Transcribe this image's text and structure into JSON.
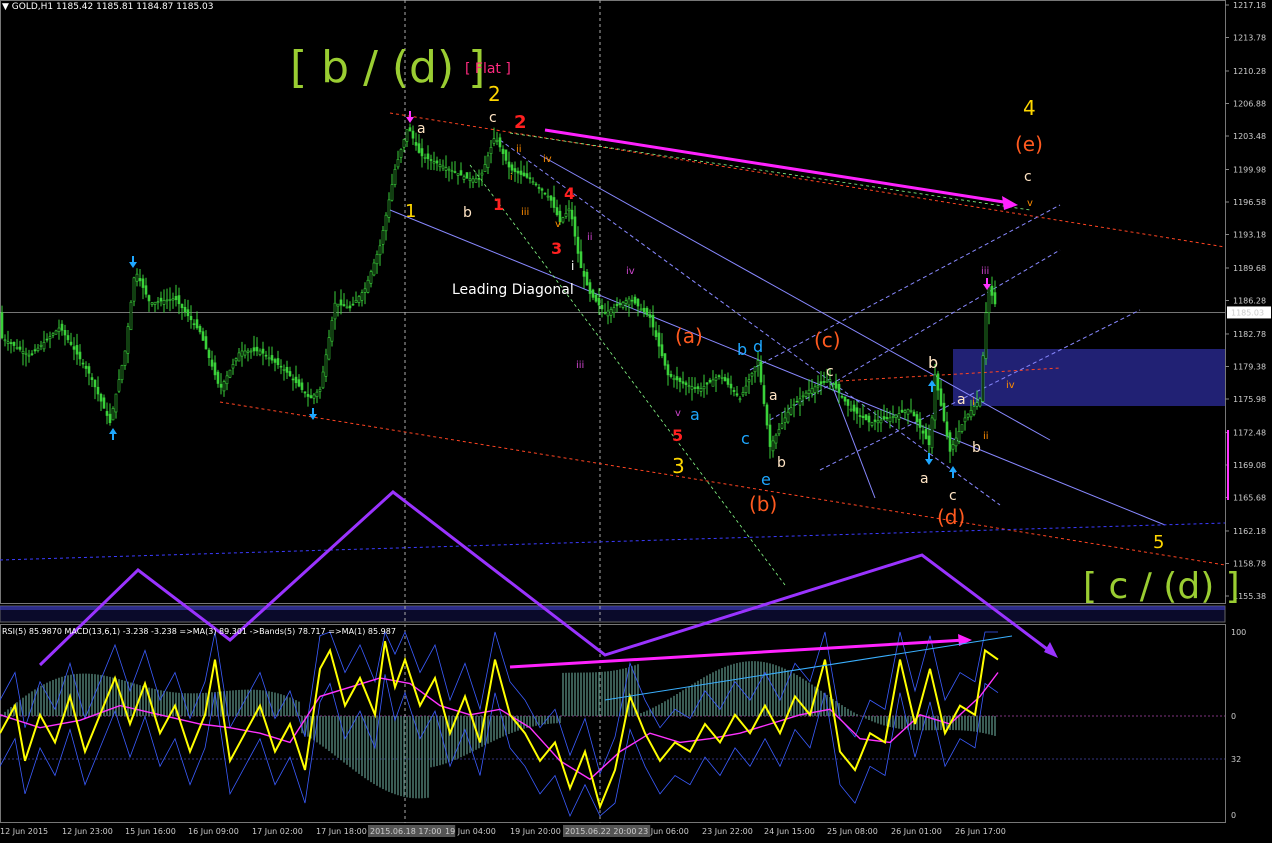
{
  "chart_header": {
    "symbol_label": "GOLD,H1",
    "ohlc": "1185.42 1185.81 1184.87 1185.03"
  },
  "indicator_header": "RSI(5) 85.9870  MACD(13,6,1) -3.238 -3.238  =>MA(3) 89.301  ->Bands(5) 78.717  =>MA(1) 85.987",
  "colors": {
    "background": "#000000",
    "candle": "#3ad13a",
    "rsi": "#ffff00",
    "rsi_ma": "#ff33ff",
    "bands": "#3b5cff",
    "magenta_arrow": "#ff22ff",
    "purple_path": "#9a33ff",
    "channel": "#8888ff",
    "trend_red": "#ff4422",
    "zone": "#23237a"
  },
  "chart_data": [
    {
      "type": "candlestick",
      "symbol": "GOLD",
      "timeframe": "H1",
      "price_ticks": [
        "1217.18",
        "1213.78",
        "1210.28",
        "1206.88",
        "1203.48",
        "1199.98",
        "1196.58",
        "1193.18",
        "1189.68",
        "1186.28",
        "1182.78",
        "1179.38",
        "1175.98",
        "1172.48",
        "1169.08",
        "1165.68",
        "1162.18",
        "1158.78",
        "1155.38"
      ],
      "ylim": [
        1153.5,
        1218.5
      ],
      "current_price": "1185.03",
      "time_ticks": [
        "12 Jun 2015",
        "12 Jun 23:00",
        "15 Jun 16:00",
        "16 Jun 09:00",
        "17 Jun 02:00",
        "17 Jun 18:00",
        "2015.06.18 17:00",
        "19 Jun 04:00",
        "19 Jun 20:00",
        "2015.06.22 20:00",
        "23 Jun 06:00",
        "23 Jun 22:00",
        "24 Jun 15:00",
        "25 Jun 08:00",
        "26 Jun 01:00",
        "26 Jun 17:00"
      ],
      "close_path": [
        [
          0,
          1182.5
        ],
        [
          30,
          1180.5
        ],
        [
          60,
          1183.5
        ],
        [
          90,
          1178.5
        ],
        [
          110,
          1173.5
        ],
        [
          125,
          1181
        ],
        [
          135,
          1189.5
        ],
        [
          150,
          1186
        ],
        [
          175,
          1186.5
        ],
        [
          200,
          1183
        ],
        [
          220,
          1177
        ],
        [
          240,
          1181
        ],
        [
          260,
          1181
        ],
        [
          285,
          1179
        ],
        [
          310,
          1176
        ],
        [
          320,
          1177
        ],
        [
          335,
          1186
        ],
        [
          350,
          1185.5
        ],
        [
          365,
          1187.5
        ],
        [
          380,
          1192
        ],
        [
          395,
          1200
        ],
        [
          408,
          1204.5
        ],
        [
          420,
          1201.5
        ],
        [
          440,
          1200.5
        ],
        [
          468,
          1199
        ],
        [
          480,
          1199
        ],
        [
          495,
          1203.5
        ],
        [
          510,
          1200
        ],
        [
          530,
          1199
        ],
        [
          550,
          1197
        ],
        [
          560,
          1194.5
        ],
        [
          570,
          1196
        ],
        [
          580,
          1190
        ],
        [
          590,
          1187
        ],
        [
          605,
          1185
        ],
        [
          630,
          1186.5
        ],
        [
          650,
          1184.5
        ],
        [
          668,
          1178.5
        ],
        [
          685,
          1177.5
        ],
        [
          700,
          1177
        ],
        [
          720,
          1178.5
        ],
        [
          740,
          1176
        ],
        [
          758,
          1180
        ],
        [
          770,
          1171
        ],
        [
          790,
          1175
        ],
        [
          810,
          1177
        ],
        [
          830,
          1178
        ],
        [
          850,
          1175
        ],
        [
          870,
          1173.5
        ],
        [
          890,
          1174
        ],
        [
          910,
          1175
        ],
        [
          930,
          1171
        ],
        [
          935,
          1178.5
        ],
        [
          950,
          1170.5
        ],
        [
          965,
          1174
        ],
        [
          980,
          1176
        ],
        [
          988,
          1188
        ],
        [
          998,
          1185.03
        ]
      ]
    },
    {
      "type": "line",
      "name": "RSI(5)",
      "yticks": [
        "100",
        "0",
        "32",
        "0"
      ],
      "series": [
        {
          "name": "RSI",
          "values": [
            [
              0,
              45
            ],
            [
              15,
              60
            ],
            [
              25,
              30
            ],
            [
              40,
              55
            ],
            [
              55,
              40
            ],
            [
              70,
              65
            ],
            [
              85,
              35
            ],
            [
              100,
              55
            ],
            [
              115,
              75
            ],
            [
              130,
              50
            ],
            [
              145,
              72
            ],
            [
              160,
              45
            ],
            [
              175,
              60
            ],
            [
              190,
              35
            ],
            [
              205,
              55
            ],
            [
              215,
              85
            ],
            [
              230,
              30
            ],
            [
              245,
              45
            ],
            [
              260,
              60
            ],
            [
              275,
              35
            ],
            [
              290,
              50
            ],
            [
              305,
              25
            ],
            [
              320,
              80
            ],
            [
              330,
              90
            ],
            [
              345,
              60
            ],
            [
              360,
              75
            ],
            [
              375,
              55
            ],
            [
              385,
              95
            ],
            [
              395,
              70
            ],
            [
              405,
              85
            ],
            [
              420,
              60
            ],
            [
              435,
              75
            ],
            [
              450,
              45
            ],
            [
              465,
              65
            ],
            [
              480,
              40
            ],
            [
              495,
              85
            ],
            [
              510,
              55
            ],
            [
              525,
              45
            ],
            [
              540,
              30
            ],
            [
              555,
              40
            ],
            [
              570,
              15
            ],
            [
              585,
              35
            ],
            [
              600,
              5
            ],
            [
              615,
              25
            ],
            [
              630,
              65
            ],
            [
              645,
              45
            ],
            [
              660,
              30
            ],
            [
              675,
              40
            ],
            [
              690,
              35
            ],
            [
              705,
              50
            ],
            [
              720,
              40
            ],
            [
              735,
              55
            ],
            [
              750,
              45
            ],
            [
              765,
              60
            ],
            [
              780,
              45
            ],
            [
              795,
              65
            ],
            [
              810,
              55
            ],
            [
              825,
              85
            ],
            [
              840,
              35
            ],
            [
              855,
              25
            ],
            [
              870,
              45
            ],
            [
              885,
              40
            ],
            [
              900,
              85
            ],
            [
              915,
              50
            ],
            [
              930,
              80
            ],
            [
              945,
              45
            ],
            [
              960,
              60
            ],
            [
              975,
              55
            ],
            [
              985,
              90
            ],
            [
              998,
              85
            ]
          ]
        },
        {
          "name": "MA",
          "values": [
            [
              0,
              55
            ],
            [
              40,
              48
            ],
            [
              80,
              52
            ],
            [
              120,
              60
            ],
            [
              160,
              55
            ],
            [
              200,
              50
            ],
            [
              230,
              48
            ],
            [
              260,
              45
            ],
            [
              290,
              40
            ],
            [
              320,
              65
            ],
            [
              350,
              70
            ],
            [
              380,
              75
            ],
            [
              410,
              72
            ],
            [
              440,
              60
            ],
            [
              470,
              55
            ],
            [
              500,
              58
            ],
            [
              530,
              48
            ],
            [
              560,
              30
            ],
            [
              590,
              20
            ],
            [
              620,
              35
            ],
            [
              650,
              45
            ],
            [
              680,
              40
            ],
            [
              710,
              42
            ],
            [
              740,
              45
            ],
            [
              770,
              50
            ],
            [
              800,
              55
            ],
            [
              830,
              58
            ],
            [
              860,
              42
            ],
            [
              890,
              40
            ],
            [
              920,
              55
            ],
            [
              950,
              50
            ],
            [
              980,
              65
            ],
            [
              998,
              78
            ]
          ]
        }
      ]
    }
  ],
  "wave_labels": [
    {
      "text": "[ b / (d) ]",
      "color": "#9acd32"
    },
    {
      "text": "[ Flat ]",
      "color": "#ff2a7f"
    },
    {
      "text": "2",
      "color": "#ffd700"
    },
    {
      "text": "c",
      "color": "#ffe4c4"
    },
    {
      "text": "2",
      "color": "#ff2020"
    },
    {
      "text": "a",
      "color": "#ffe4c4"
    },
    {
      "text": "ii",
      "color": "#ff8c00"
    },
    {
      "text": "iv",
      "color": "#ff8c00"
    },
    {
      "text": "1",
      "color": "#ffd700"
    },
    {
      "text": "b",
      "color": "#ffe4c4"
    },
    {
      "text": "1",
      "color": "#ff2020"
    },
    {
      "text": "i",
      "color": "#ff8c00"
    },
    {
      "text": "iii",
      "color": "#ff8c00"
    },
    {
      "text": "4",
      "color": "#ff2020"
    },
    {
      "text": "v",
      "color": "#ff8c00"
    },
    {
      "text": "ii",
      "color": "#cc44cc"
    },
    {
      "text": "3",
      "color": "#ff2020"
    },
    {
      "text": "i",
      "color": "#ffffff"
    },
    {
      "text": "iv",
      "color": "#cc44cc"
    },
    {
      "text": "Leading Diagonal",
      "color": "#ffffff"
    },
    {
      "text": "iii",
      "color": "#cc44cc"
    },
    {
      "text": "(a)",
      "color": "#ff5a1f"
    },
    {
      "text": "v",
      "color": "#cc44cc"
    },
    {
      "text": "a",
      "color": "#1ea7ff"
    },
    {
      "text": "5",
      "color": "#ff2020"
    },
    {
      "text": "3",
      "color": "#ffd700"
    },
    {
      "text": "b",
      "color": "#1ea7ff"
    },
    {
      "text": "d",
      "color": "#1ea7ff"
    },
    {
      "text": "c",
      "color": "#1ea7ff"
    },
    {
      "text": "a",
      "color": "#ffe4c4"
    },
    {
      "text": "e",
      "color": "#1ea7ff"
    },
    {
      "text": "b",
      "color": "#ffe4c4"
    },
    {
      "text": "(b)",
      "color": "#ff5a1f"
    },
    {
      "text": "(c)",
      "color": "#ff5a1f"
    },
    {
      "text": "c",
      "color": "#ffe4c4"
    },
    {
      "text": "b",
      "color": "#ffe4c4"
    },
    {
      "text": "a",
      "color": "#ffe4c4"
    },
    {
      "text": "c",
      "color": "#ffe4c4"
    },
    {
      "text": "(d)",
      "color": "#ff5a1f"
    },
    {
      "text": "a",
      "color": "#ffe4c4"
    },
    {
      "text": "b",
      "color": "#ffe4c4"
    },
    {
      "text": "ii",
      "color": "#ff8c00"
    },
    {
      "text": "i",
      "color": "#ff8c00"
    },
    {
      "text": "iv",
      "color": "#ff8c00"
    },
    {
      "text": "iii",
      "color": "#cc44cc"
    },
    {
      "text": "4",
      "color": "#ffd700"
    },
    {
      "text": "(e)",
      "color": "#ff5a1f"
    },
    {
      "text": "c",
      "color": "#ffe4c4"
    },
    {
      "text": "v",
      "color": "#ff8c00"
    },
    {
      "text": "5",
      "color": "#ffd700"
    },
    {
      "text": "[ c / (d) ]",
      "color": "#9acd32"
    }
  ]
}
